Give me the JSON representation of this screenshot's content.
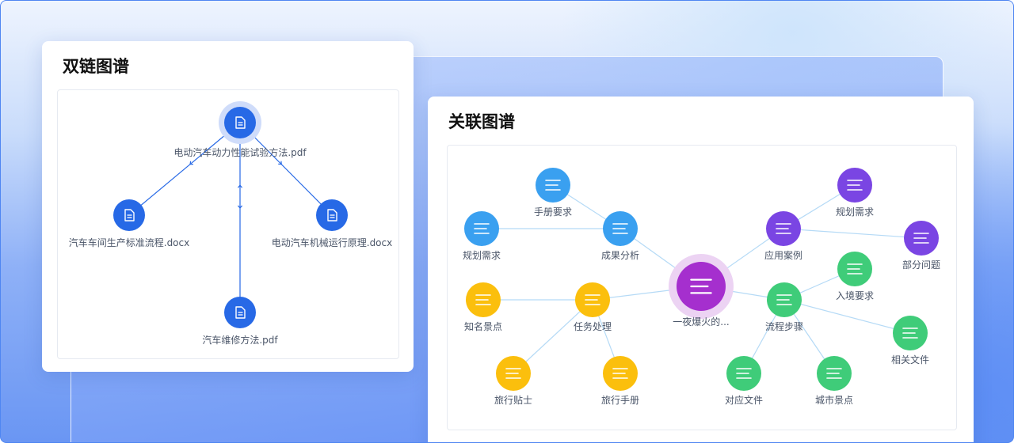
{
  "left_card": {
    "title": "双链图谱",
    "nodes": [
      {
        "id": "root",
        "label": "电动汽车动力性能试验方法.pdf"
      },
      {
        "id": "l",
        "label": "汽车车间生产标准流程.docx"
      },
      {
        "id": "r",
        "label": "电动汽车机械运行原理.docx"
      },
      {
        "id": "b",
        "label": "汽车维修方法.pdf"
      }
    ],
    "edges": [
      {
        "from": "root",
        "to": "l",
        "type": "arrow"
      },
      {
        "from": "root",
        "to": "r",
        "type": "arrow"
      },
      {
        "from": "root",
        "to": "b",
        "type": "bidirectional"
      }
    ]
  },
  "right_card": {
    "title": "关联图谱",
    "colors": {
      "blue": "#3aa0f0",
      "yellow": "#fbbf0d",
      "purple": "#7a45e3",
      "green": "#3fcc79",
      "center": "#a52fce"
    },
    "nodes": [
      {
        "id": "center",
        "label": "一夜爆火的...",
        "color": "center"
      },
      {
        "id": "cgfx",
        "label": "成果分析",
        "color": "blue"
      },
      {
        "id": "scyq",
        "label": "手册要求",
        "color": "blue"
      },
      {
        "id": "ghxq1",
        "label": "规划需求",
        "color": "blue"
      },
      {
        "id": "rwcl",
        "label": "任务处理",
        "color": "yellow"
      },
      {
        "id": "zmjd",
        "label": "知名景点",
        "color": "yellow"
      },
      {
        "id": "lxtsh",
        "label": "旅行贴士",
        "color": "yellow"
      },
      {
        "id": "lxsc",
        "label": "旅行手册",
        "color": "yellow"
      },
      {
        "id": "yyal",
        "label": "应用案例",
        "color": "purple"
      },
      {
        "id": "ghxq2",
        "label": "规划需求",
        "color": "purple"
      },
      {
        "id": "bfwt",
        "label": "部分问题",
        "color": "purple"
      },
      {
        "id": "lcbz",
        "label": "流程步骤",
        "color": "green"
      },
      {
        "id": "rjyq",
        "label": "入境要求",
        "color": "green"
      },
      {
        "id": "xgwj",
        "label": "相关文件",
        "color": "green"
      },
      {
        "id": "dywj",
        "label": "对应文件",
        "color": "green"
      },
      {
        "id": "csjd",
        "label": "城市景点",
        "color": "green"
      }
    ],
    "edges": [
      [
        "center",
        "cgfx"
      ],
      [
        "center",
        "rwcl"
      ],
      [
        "center",
        "yyal"
      ],
      [
        "center",
        "lcbz"
      ],
      [
        "cgfx",
        "scyq"
      ],
      [
        "cgfx",
        "ghxq1"
      ],
      [
        "rwcl",
        "zmjd"
      ],
      [
        "rwcl",
        "lxtsh"
      ],
      [
        "rwcl",
        "lxsc"
      ],
      [
        "yyal",
        "ghxq2"
      ],
      [
        "yyal",
        "bfwt"
      ],
      [
        "lcbz",
        "rjyq"
      ],
      [
        "lcbz",
        "xgwj"
      ],
      [
        "lcbz",
        "dywj"
      ],
      [
        "lcbz",
        "csjd"
      ]
    ]
  }
}
